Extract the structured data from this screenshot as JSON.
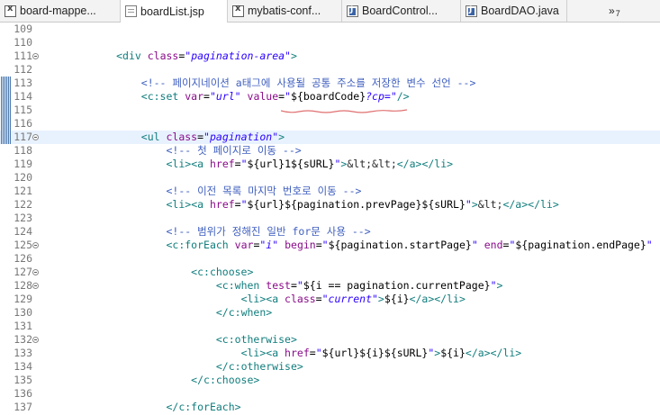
{
  "tabs": [
    {
      "label": "board-mappe...",
      "icon": "xml-file-icon",
      "active": false
    },
    {
      "label": "boardList.jsp",
      "icon": "jsp-file-icon",
      "active": true
    },
    {
      "label": "mybatis-conf...",
      "icon": "xml-file-icon",
      "active": false
    },
    {
      "label": "BoardControl...",
      "icon": "java-file-icon",
      "active": false
    },
    {
      "label": "BoardDAO.java",
      "icon": "java-file-icon",
      "active": false
    }
  ],
  "overflow": {
    "symbol": "»",
    "count": "7"
  },
  "editor": {
    "lines": [
      {
        "number": "109",
        "fold": false,
        "changed": false,
        "current": false,
        "tokens": []
      },
      {
        "number": "110",
        "fold": false,
        "changed": false,
        "current": false,
        "tokens": []
      },
      {
        "number": "111",
        "fold": true,
        "changed": false,
        "current": false,
        "tokens": [
          {
            "t": "            ",
            "c": ""
          },
          {
            "t": "<div ",
            "c": "tag"
          },
          {
            "t": "class",
            "c": "attr"
          },
          {
            "t": "=",
            "c": ""
          },
          {
            "t": "\"pagination-area\"",
            "c": "val"
          },
          {
            "t": ">",
            "c": "tag"
          }
        ]
      },
      {
        "number": "112",
        "fold": false,
        "changed": false,
        "current": false,
        "tokens": []
      },
      {
        "number": "113",
        "fold": false,
        "changed": true,
        "current": false,
        "tokens": [
          {
            "t": "                ",
            "c": ""
          },
          {
            "t": "<!-- 페이지네이션 a태그에 사용될 공통 주소를 저장한 변수 선언 -->",
            "c": "com"
          }
        ]
      },
      {
        "number": "114",
        "fold": false,
        "changed": true,
        "current": false,
        "tokens": [
          {
            "t": "                ",
            "c": ""
          },
          {
            "t": "<c:set ",
            "c": "tag"
          },
          {
            "t": "var",
            "c": "attr"
          },
          {
            "t": "=",
            "c": ""
          },
          {
            "t": "\"url\"",
            "c": "val"
          },
          {
            "t": " ",
            "c": ""
          },
          {
            "t": "value",
            "c": "attr"
          },
          {
            "t": "=",
            "c": ""
          },
          {
            "t": "\"",
            "c": "val"
          },
          {
            "t": "${boardCode}",
            "c": "el"
          },
          {
            "t": "?cp=\"",
            "c": "val"
          },
          {
            "t": "/>",
            "c": "tag"
          }
        ]
      },
      {
        "number": "115",
        "fold": false,
        "changed": true,
        "current": false,
        "tokens": []
      },
      {
        "number": "116",
        "fold": false,
        "changed": true,
        "current": false,
        "tokens": []
      },
      {
        "number": "117",
        "fold": true,
        "changed": true,
        "current": true,
        "tokens": [
          {
            "t": "                ",
            "c": ""
          },
          {
            "t": "<ul ",
            "c": "tag"
          },
          {
            "t": "class",
            "c": "attr"
          },
          {
            "t": "=",
            "c": ""
          },
          {
            "t": "\"pagination\"",
            "c": "val"
          },
          {
            "t": ">",
            "c": "tag"
          }
        ]
      },
      {
        "number": "118",
        "fold": false,
        "changed": false,
        "current": false,
        "tokens": [
          {
            "t": "                    ",
            "c": ""
          },
          {
            "t": "<!-- 첫 페이지로 이동 -->",
            "c": "com"
          }
        ]
      },
      {
        "number": "119",
        "fold": false,
        "changed": false,
        "current": false,
        "tokens": [
          {
            "t": "                    ",
            "c": ""
          },
          {
            "t": "<li>",
            "c": "tag"
          },
          {
            "t": "<a ",
            "c": "tag"
          },
          {
            "t": "href",
            "c": "attr"
          },
          {
            "t": "=",
            "c": ""
          },
          {
            "t": "\"",
            "c": "val"
          },
          {
            "t": "${url}1${sURL}",
            "c": "el"
          },
          {
            "t": "\"",
            "c": "val"
          },
          {
            "t": ">",
            "c": "tag"
          },
          {
            "t": "&lt;&lt;",
            "c": "ent"
          },
          {
            "t": "</a></li>",
            "c": "tag"
          }
        ]
      },
      {
        "number": "120",
        "fold": false,
        "changed": false,
        "current": false,
        "tokens": []
      },
      {
        "number": "121",
        "fold": false,
        "changed": false,
        "current": false,
        "tokens": [
          {
            "t": "                    ",
            "c": ""
          },
          {
            "t": "<!-- 이전 목록 마지막 번호로 이동 -->",
            "c": "com"
          }
        ]
      },
      {
        "number": "122",
        "fold": false,
        "changed": false,
        "current": false,
        "tokens": [
          {
            "t": "                    ",
            "c": ""
          },
          {
            "t": "<li>",
            "c": "tag"
          },
          {
            "t": "<a ",
            "c": "tag"
          },
          {
            "t": "href",
            "c": "attr"
          },
          {
            "t": "=",
            "c": ""
          },
          {
            "t": "\"",
            "c": "val"
          },
          {
            "t": "${url}${pagination.prevPage}${sURL}",
            "c": "el"
          },
          {
            "t": "\"",
            "c": "val"
          },
          {
            "t": ">",
            "c": "tag"
          },
          {
            "t": "&lt;",
            "c": "ent"
          },
          {
            "t": "</a></li>",
            "c": "tag"
          }
        ]
      },
      {
        "number": "123",
        "fold": false,
        "changed": false,
        "current": false,
        "tokens": []
      },
      {
        "number": "124",
        "fold": false,
        "changed": false,
        "current": false,
        "tokens": [
          {
            "t": "                    ",
            "c": ""
          },
          {
            "t": "<!-- 범위가 정해진 일반 for문 사용 -->",
            "c": "com"
          }
        ]
      },
      {
        "number": "125",
        "fold": true,
        "changed": false,
        "current": false,
        "tokens": [
          {
            "t": "                    ",
            "c": ""
          },
          {
            "t": "<c:forEach ",
            "c": "tag"
          },
          {
            "t": "var",
            "c": "attr"
          },
          {
            "t": "=",
            "c": ""
          },
          {
            "t": "\"i\"",
            "c": "val"
          },
          {
            "t": " ",
            "c": ""
          },
          {
            "t": "begin",
            "c": "attr"
          },
          {
            "t": "=",
            "c": ""
          },
          {
            "t": "\"",
            "c": "val"
          },
          {
            "t": "${pagination.startPage}",
            "c": "el"
          },
          {
            "t": "\"",
            "c": "val"
          },
          {
            "t": " ",
            "c": ""
          },
          {
            "t": "end",
            "c": "attr"
          },
          {
            "t": "=",
            "c": ""
          },
          {
            "t": "\"",
            "c": "val"
          },
          {
            "t": "${pagination.endPage}",
            "c": "el"
          },
          {
            "t": "\"",
            "c": "val"
          }
        ]
      },
      {
        "number": "126",
        "fold": false,
        "changed": false,
        "current": false,
        "tokens": []
      },
      {
        "number": "127",
        "fold": true,
        "changed": false,
        "current": false,
        "tokens": [
          {
            "t": "                        ",
            "c": ""
          },
          {
            "t": "<c:choose>",
            "c": "tag"
          }
        ]
      },
      {
        "number": "128",
        "fold": true,
        "changed": false,
        "current": false,
        "tokens": [
          {
            "t": "                            ",
            "c": ""
          },
          {
            "t": "<c:when ",
            "c": "tag"
          },
          {
            "t": "test",
            "c": "attr"
          },
          {
            "t": "=",
            "c": ""
          },
          {
            "t": "\"",
            "c": "val"
          },
          {
            "t": "${i == pagination.currentPage}",
            "c": "el"
          },
          {
            "t": "\"",
            "c": "val"
          },
          {
            "t": ">",
            "c": "tag"
          }
        ]
      },
      {
        "number": "129",
        "fold": false,
        "changed": false,
        "current": false,
        "tokens": [
          {
            "t": "                                ",
            "c": ""
          },
          {
            "t": "<li>",
            "c": "tag"
          },
          {
            "t": "<a ",
            "c": "tag"
          },
          {
            "t": "class",
            "c": "attr"
          },
          {
            "t": "=",
            "c": ""
          },
          {
            "t": "\"current\"",
            "c": "val"
          },
          {
            "t": ">",
            "c": "tag"
          },
          {
            "t": "${i}",
            "c": "el"
          },
          {
            "t": "</a></li>",
            "c": "tag"
          }
        ]
      },
      {
        "number": "130",
        "fold": false,
        "changed": false,
        "current": false,
        "tokens": [
          {
            "t": "                            ",
            "c": ""
          },
          {
            "t": "</c:when>",
            "c": "tag"
          }
        ]
      },
      {
        "number": "131",
        "fold": false,
        "changed": false,
        "current": false,
        "tokens": []
      },
      {
        "number": "132",
        "fold": true,
        "changed": false,
        "current": false,
        "tokens": [
          {
            "t": "                            ",
            "c": ""
          },
          {
            "t": "<c:otherwise>",
            "c": "tag"
          }
        ]
      },
      {
        "number": "133",
        "fold": false,
        "changed": false,
        "current": false,
        "tokens": [
          {
            "t": "                                ",
            "c": ""
          },
          {
            "t": "<li>",
            "c": "tag"
          },
          {
            "t": "<a ",
            "c": "tag"
          },
          {
            "t": "href",
            "c": "attr"
          },
          {
            "t": "=",
            "c": ""
          },
          {
            "t": "\"",
            "c": "val"
          },
          {
            "t": "${url}${i}${sURL}",
            "c": "el"
          },
          {
            "t": "\"",
            "c": "val"
          },
          {
            "t": ">",
            "c": "tag"
          },
          {
            "t": "${i}",
            "c": "el"
          },
          {
            "t": "</a></li>",
            "c": "tag"
          }
        ]
      },
      {
        "number": "134",
        "fold": false,
        "changed": false,
        "current": false,
        "tokens": [
          {
            "t": "                            ",
            "c": ""
          },
          {
            "t": "</c:otherwise>",
            "c": "tag"
          }
        ]
      },
      {
        "number": "135",
        "fold": false,
        "changed": false,
        "current": false,
        "tokens": [
          {
            "t": "                        ",
            "c": ""
          },
          {
            "t": "</c:choose>",
            "c": "tag"
          }
        ]
      },
      {
        "number": "136",
        "fold": false,
        "changed": false,
        "current": false,
        "tokens": []
      },
      {
        "number": "137",
        "fold": false,
        "changed": false,
        "current": false,
        "tokens": [
          {
            "t": "                    ",
            "c": ""
          },
          {
            "t": "</c:forEach>",
            "c": "tag"
          }
        ]
      }
    ]
  }
}
